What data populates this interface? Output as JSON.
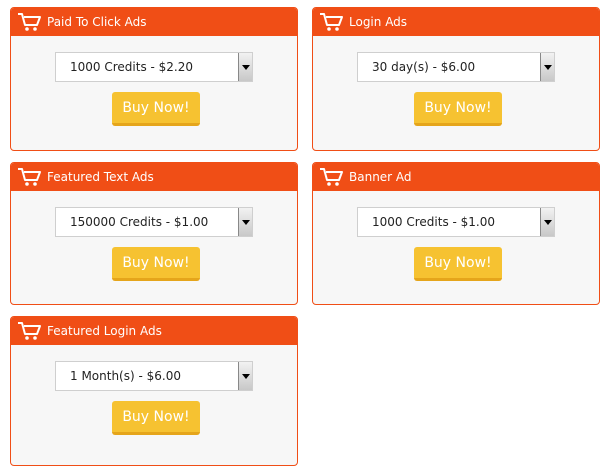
{
  "colors": {
    "header": "#f04e16",
    "card_bg": "#f7f7f7",
    "button": "#f6c231",
    "button_text": "#ffffff"
  },
  "cards": [
    {
      "title": "Paid To Click Ads",
      "selected_option": "1000 Credits - $2.20",
      "button_label": "Buy Now!",
      "icon": "shopping-cart-icon"
    },
    {
      "title": "Login Ads",
      "selected_option": "30 day(s) - $6.00",
      "button_label": "Buy Now!",
      "icon": "shopping-cart-icon"
    },
    {
      "title": "Featured Text Ads",
      "selected_option": "150000 Credits - $1.00",
      "button_label": "Buy Now!",
      "icon": "shopping-cart-icon"
    },
    {
      "title": "Banner Ad",
      "selected_option": "1000 Credits - $1.00",
      "button_label": "Buy Now!",
      "icon": "shopping-cart-icon"
    },
    {
      "title": "Featured Login Ads",
      "selected_option": "1 Month(s) - $6.00",
      "button_label": "Buy Now!",
      "icon": "shopping-cart-icon"
    }
  ]
}
